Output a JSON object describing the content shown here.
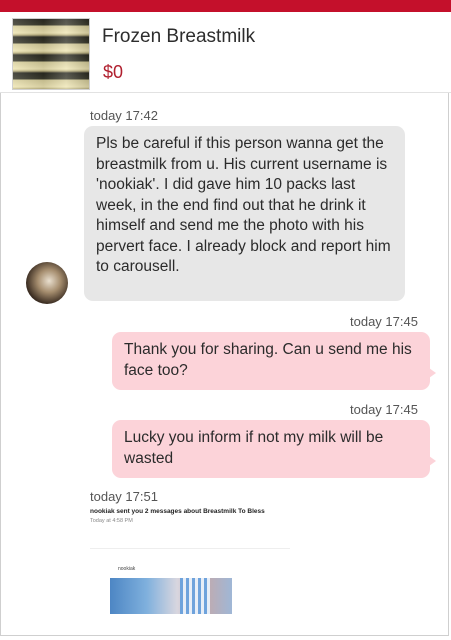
{
  "listing": {
    "title": "Frozen Breastmilk",
    "price": "$0"
  },
  "messages": [
    {
      "time": "today 17:42",
      "text": "Pls be careful if this person wanna get the breastmilk from u. His current username is 'nookiak'. I did gave him 10 packs last week, in the end find out that he drink it himself and send me the photo with his pervert face. I already block and report him to carousell."
    },
    {
      "time": "today 17:45",
      "text": "Thank you for sharing. Can u send me his face too?"
    },
    {
      "time": "today 17:45",
      "text": "Lucky you inform if not my milk will be wasted"
    },
    {
      "time": "today 17:51",
      "notification_title": "nookiak sent you 2 messages about Breastmilk To Bless",
      "notification_time": "Today at 4:58 PM",
      "sender": "nookiak"
    }
  ]
}
